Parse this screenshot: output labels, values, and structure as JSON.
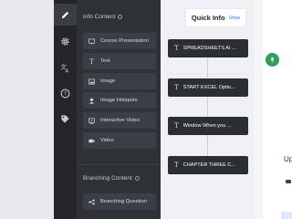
{
  "sidebar_rail": {
    "items": [
      {
        "icon": "pencil-icon",
        "active": true
      },
      {
        "icon": "gear-icon",
        "active": false
      },
      {
        "icon": "translate-icon",
        "active": false
      },
      {
        "icon": "help-icon",
        "active": false
      },
      {
        "icon": "tag-icon",
        "active": false
      }
    ]
  },
  "info_content": {
    "title": "Info Content",
    "items": [
      {
        "label": "Course Presentation",
        "icon": "presentation-icon"
      },
      {
        "label": "Text",
        "icon": "text-icon"
      },
      {
        "label": "Image",
        "icon": "image-icon"
      },
      {
        "label": "Image Hotspots",
        "icon": "hotspot-icon"
      },
      {
        "label": "Interactive Video",
        "icon": "interactive-video-icon"
      },
      {
        "label": "Video",
        "icon": "video-icon"
      }
    ]
  },
  "branching_content": {
    "title": "Branching Content",
    "items": [
      {
        "label": "Branching Question",
        "icon": "branching-icon"
      }
    ]
  },
  "canvas": {
    "quick_info": {
      "title": "Quick Info",
      "action": "Show"
    },
    "nodes": [
      {
        "type_glyph": "T",
        "label": "SPREADSHEETS AI ..."
      },
      {
        "type_glyph": "T",
        "label": "START EXCEL Optio..."
      },
      {
        "type_glyph": "T",
        "label": "Window When you ..."
      },
      {
        "type_glyph": "T",
        "label": "CHAPTER THREE C..."
      }
    ]
  },
  "right_pane": {
    "partial_text": "Up"
  },
  "colors": {
    "rail_bg": "#232529",
    "panel_bg": "#2e3136",
    "item_bg": "#3b3e44",
    "node_bg": "#2b2e33",
    "canvas_bg": "#eef0f3",
    "accent_blue": "#2f80ed",
    "accent_green": "#2e9e58"
  }
}
